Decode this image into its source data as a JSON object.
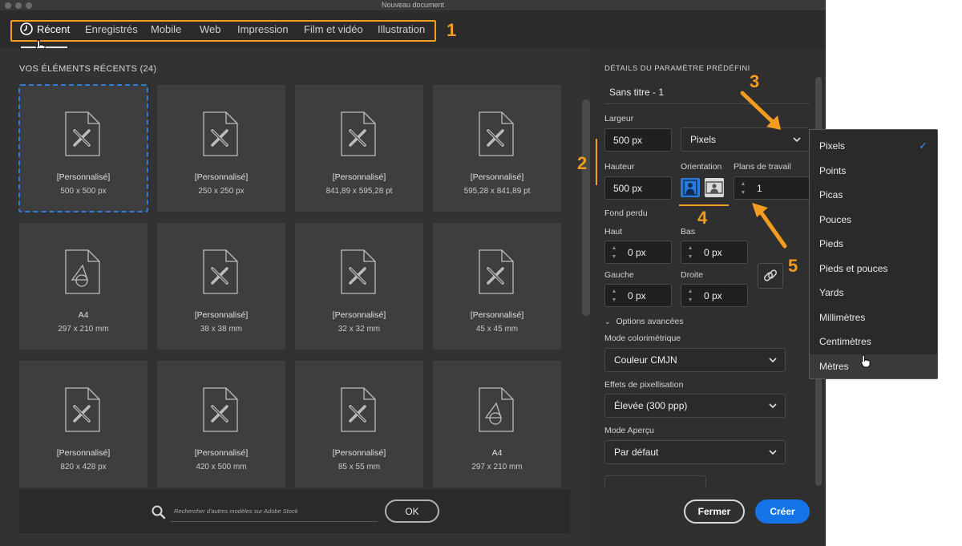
{
  "window": {
    "title": "Nouveau document"
  },
  "tabs": [
    {
      "label": "Récent",
      "active": true
    },
    {
      "label": "Enregistrés"
    },
    {
      "label": "Mobile"
    },
    {
      "label": "Web"
    },
    {
      "label": "Impression"
    },
    {
      "label": "Film et vidéo"
    },
    {
      "label": "Illustration"
    }
  ],
  "annotations": {
    "a1": "1",
    "a2": "2",
    "a3": "3",
    "a4": "4",
    "a5": "5",
    "color": "#f39c1f"
  },
  "recent": {
    "title": "VOS ÉLÉMENTS RÉCENTS",
    "count": "(24)",
    "items": [
      {
        "name": "[Personnalisé]",
        "size": "500 x 500 px",
        "icon": "custom-doc-icon",
        "selected": true
      },
      {
        "name": "[Personnalisé]",
        "size": "250 x 250 px",
        "icon": "custom-doc-icon"
      },
      {
        "name": "[Personnalisé]",
        "size": "841,89 x 595,28 pt",
        "icon": "custom-doc-icon"
      },
      {
        "name": "[Personnalisé]",
        "size": "595,28 x 841,89 pt",
        "icon": "custom-doc-icon"
      },
      {
        "name": "A4",
        "size": "297 x 210 mm",
        "icon": "shapes-doc-icon"
      },
      {
        "name": "[Personnalisé]",
        "size": "38 x 38 mm",
        "icon": "custom-doc-icon"
      },
      {
        "name": "[Personnalisé]",
        "size": "32 x 32 mm",
        "icon": "custom-doc-icon"
      },
      {
        "name": "[Personnalisé]",
        "size": "45 x 45 mm",
        "icon": "custom-doc-icon"
      },
      {
        "name": "[Personnalisé]",
        "size": "820 x 428 px",
        "icon": "custom-doc-icon"
      },
      {
        "name": "[Personnalisé]",
        "size": "420 x 500 mm",
        "icon": "custom-doc-icon"
      },
      {
        "name": "[Personnalisé]",
        "size": "85 x 55 mm",
        "icon": "custom-doc-icon"
      },
      {
        "name": "A4",
        "size": "297 x 210 mm",
        "icon": "shapes-doc-icon"
      }
    ]
  },
  "search": {
    "placeholder": "Rechercher d'autres modèles sur Adobe Stock",
    "ok_label": "OK"
  },
  "preset": {
    "header": "DÉTAILS DU PARAMÈTRE PRÉDÉFINI",
    "name": "Sans titre - 1",
    "width_label": "Largeur",
    "width_value": "500 px",
    "unit_value": "Pixels",
    "height_label": "Hauteur",
    "height_value": "500 px",
    "orientation_label": "Orientation",
    "artboards_label": "Plans de travail",
    "artboards_value": "1",
    "bleed_label": "Fond perdu",
    "top_label": "Haut",
    "top_value": "0 px",
    "bottom_label": "Bas",
    "bottom_value": "0 px",
    "left_label": "Gauche",
    "left_value": "0 px",
    "right_label": "Droite",
    "right_value": "0 px",
    "advanced_label": "Options avancées",
    "color_mode_label": "Mode colorimétrique",
    "color_mode_value": "Couleur CMJN",
    "raster_label": "Effets de pixellisation",
    "raster_value": "Élevée (300 ppp)",
    "preview_label": "Mode Aperçu",
    "preview_value": "Par défaut"
  },
  "buttons": {
    "close": "Fermer",
    "create": "Créer"
  },
  "unit_menu": {
    "items": [
      "Pixels",
      "Points",
      "Picas",
      "Pouces",
      "Pieds",
      "Pieds et pouces",
      "Yards",
      "Millimètres",
      "Centimètres",
      "Mètres"
    ],
    "checked": "Pixels",
    "hovered": "Mètres"
  },
  "colors": {
    "accent": "#1473e6",
    "selection": "#2f7bdc",
    "annotation": "#f39c1f"
  }
}
